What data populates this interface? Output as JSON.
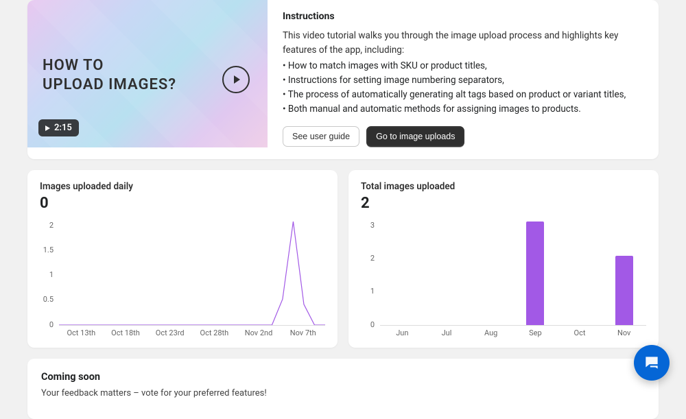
{
  "hero": {
    "video_title_line1": "HOW TO",
    "video_title_line2": "UPLOAD IMAGES?",
    "duration": "2:15",
    "heading": "Instructions",
    "intro": "This video tutorial walks you through the image upload process and highlights key features of the app, including:",
    "bullets": [
      "• How to match images with SKU or product titles,",
      "• Instructions for setting image numbering separators,",
      "• The process of automatically generating alt tags based on product or variant titles,",
      "• Both manual and automatic methods for assigning images to products."
    ],
    "btn_secondary": "See user guide",
    "btn_primary": "Go to image uploads"
  },
  "chart_data": [
    {
      "type": "line",
      "title": "Images uploaded daily",
      "headline_value": "0",
      "x_ticks": [
        "Oct 13th",
        "Oct 18th",
        "Oct 23rd",
        "Oct 28th",
        "Nov 2nd",
        "Nov 7th"
      ],
      "y_ticks": [
        "2",
        "1.5",
        "1",
        "0.5",
        "0"
      ],
      "ylim": [
        0,
        2
      ],
      "points": [
        {
          "i": 0,
          "y": 0
        },
        {
          "i": 5,
          "y": 0
        },
        {
          "i": 18,
          "y": 0
        },
        {
          "i": 20,
          "y": 0
        },
        {
          "i": 21,
          "y": 0.5
        },
        {
          "i": 22,
          "y": 2
        },
        {
          "i": 23,
          "y": 0.4
        },
        {
          "i": 24,
          "y": 0
        },
        {
          "i": 25,
          "y": 0
        }
      ],
      "n_points": 25,
      "color": "#a259e6"
    },
    {
      "type": "bar",
      "title": "Total images uploaded",
      "headline_value": "2",
      "y_ticks": [
        "3",
        "2",
        "1",
        "0"
      ],
      "ylim": [
        0,
        3
      ],
      "categories": [
        "Jun",
        "Jul",
        "Aug",
        "Sep",
        "Oct",
        "Nov"
      ],
      "values": [
        0,
        0,
        0,
        3,
        0,
        2
      ],
      "color": "#a259e6"
    }
  ],
  "coming": {
    "heading": "Coming soon",
    "text": "Your feedback matters – vote for your preferred features!"
  }
}
